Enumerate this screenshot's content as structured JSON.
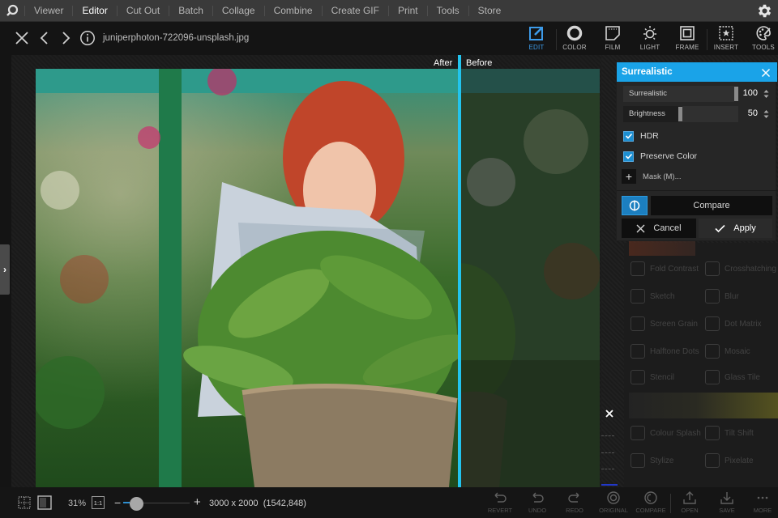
{
  "menu": {
    "items": [
      "Viewer",
      "Editor",
      "Cut Out",
      "Batch",
      "Collage",
      "Combine",
      "Create GIF",
      "Print",
      "Tools",
      "Store"
    ],
    "active": "Editor"
  },
  "file": {
    "name": "juniperphoton-722096-unsplash.jpg"
  },
  "tools": [
    {
      "label": "EDIT",
      "icon": "edit-icon",
      "active": true
    },
    {
      "label": "COLOR",
      "icon": "color-icon"
    },
    {
      "label": "FILM",
      "icon": "film-icon"
    },
    {
      "label": "LIGHT",
      "icon": "light-icon"
    },
    {
      "label": "FRAME",
      "icon": "frame-icon"
    },
    {
      "label": "INSERT",
      "icon": "insert-icon"
    },
    {
      "label": "TOOLS",
      "icon": "tools-icon"
    }
  ],
  "compare_view": {
    "after_label": "After",
    "before_label": "Before"
  },
  "effect_panel": {
    "title": "Surrealistic",
    "sliders": [
      {
        "label": "Surrealistic",
        "value": "100",
        "fraction": 1.0
      },
      {
        "label": "Brightness",
        "value": "50",
        "fraction": 0.5
      }
    ],
    "checkboxes": [
      {
        "label": "HDR",
        "checked": true
      },
      {
        "label": "Preserve Color",
        "checked": true
      }
    ],
    "mask_label": "Mask (M)...",
    "compare_label": "Compare",
    "cancel_label": "Cancel",
    "apply_label": "Apply"
  },
  "background_effects": [
    "Fold Contrast",
    "Crosshatching",
    "Sketch",
    "Blur",
    "Screen Grain",
    "Dot Matrix",
    "Halftone Dots",
    "Mosaic",
    "Stencil",
    "Glass Tile",
    "Colour Splash",
    "Tilt Shift",
    "Stylize",
    "Pixelate"
  ],
  "status": {
    "zoom": "31%",
    "one_to_one": "1:1",
    "zoom_fraction": 0.1,
    "dimensions": "3000 x 2000",
    "cursor": "(1542,848)"
  },
  "actions": [
    "REVERT",
    "UNDO",
    "REDO",
    "ORIGINAL",
    "COMPARE",
    "OPEN",
    "SAVE",
    "MORE"
  ],
  "colors": {
    "accent": "#1aa3e8",
    "divider": "#22c4ee",
    "active_tool": "#3d9be9",
    "checkbox": "#1c8fd2"
  }
}
